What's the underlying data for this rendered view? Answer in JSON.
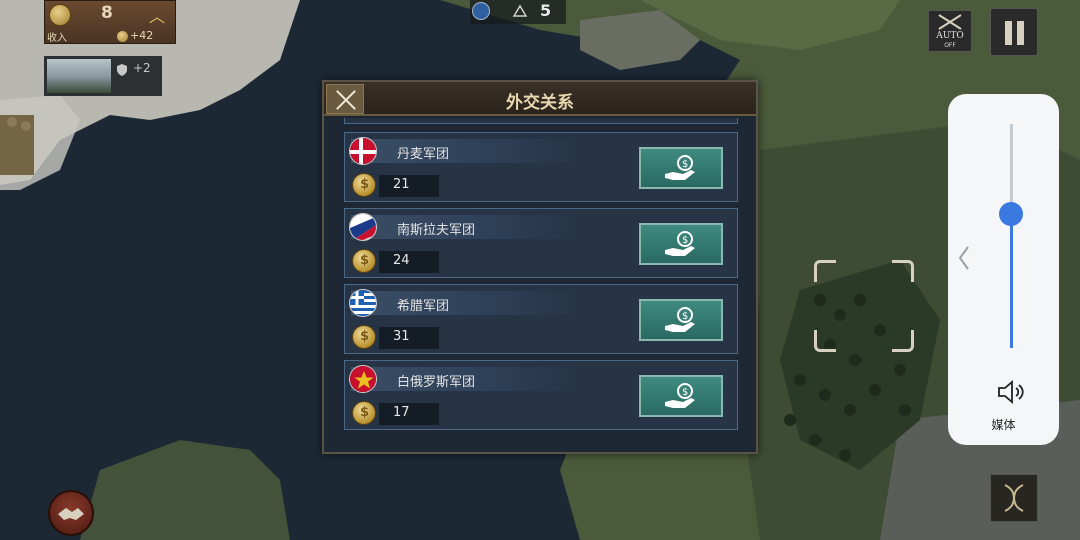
{
  "hud": {
    "gold": "8",
    "income_label": "收入",
    "income": "+42",
    "defense": "+2",
    "troops": "5"
  },
  "controls": {
    "auto_label": "AUTO",
    "auto_state": "OFF"
  },
  "dialog": {
    "title": "外交关系",
    "rows": [
      {
        "name": "丹麦军团",
        "value": "21",
        "flag": "denmark-flag-icon"
      },
      {
        "name": "南斯拉夫军团",
        "value": "24",
        "flag": "yugoslavia-flag-icon"
      },
      {
        "name": "希腊军团",
        "value": "31",
        "flag": "greece-flag-icon"
      },
      {
        "name": "白俄罗斯军团",
        "value": "17",
        "flag": "red-star-flag-icon"
      }
    ]
  },
  "volume": {
    "label": "媒体",
    "level": 0.6
  },
  "colors": {
    "accent_button": "#3e8a80",
    "dialog_header": "#3a3026",
    "row_border": "#4a6888",
    "volume_accent": "#3a7ae0"
  }
}
